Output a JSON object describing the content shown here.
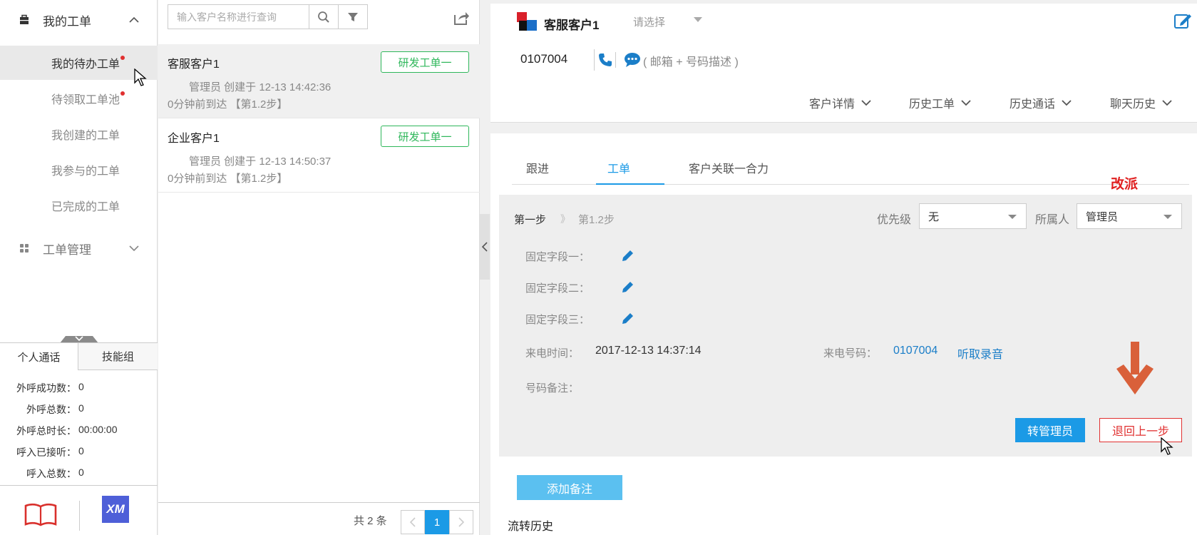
{
  "sidebar": {
    "group_my_tickets": "我的工单",
    "items": [
      {
        "label": "我的待办工单",
        "dot": true
      },
      {
        "label": "待领取工单池",
        "dot": true
      },
      {
        "label": "我创建的工单",
        "dot": false
      },
      {
        "label": "我参与的工单",
        "dot": false
      },
      {
        "label": "已完成的工单",
        "dot": false
      }
    ],
    "group_ticket_mgmt": "工单管理",
    "stats_tabs": [
      "个人通话",
      "技能组"
    ],
    "stats": [
      {
        "label": "外呼成功数：",
        "value": "0"
      },
      {
        "label": "外呼总数：",
        "value": "0"
      },
      {
        "label": "外呼总时长：",
        "value": "00:00:00"
      },
      {
        "label": "呼入已接听：",
        "value": "0"
      },
      {
        "label": "呼入总数：",
        "value": "0"
      }
    ],
    "bottom_logo_text": "XM"
  },
  "list": {
    "search_placeholder": "输入客户名称进行查询",
    "cards": [
      {
        "title": "客服客户1",
        "tag": "研发工单一",
        "meta": "管理员 创建于 12-13 14:42:36",
        "arrival": "0分钟前到达 【第1.2步】"
      },
      {
        "title": "企业客户1",
        "tag": "研发工单一",
        "meta": "管理员 创建于 12-13 14:50:37",
        "arrival": "0分钟前到达 【第1.2步】"
      }
    ],
    "total": "共 2 条",
    "page": "1"
  },
  "customer": {
    "name": "客服客户1",
    "select_placeholder": "请选择",
    "phone": "0107004",
    "contact_desc": "( 邮箱 + 号码描述 )",
    "tabs": [
      "客户详情",
      "历史工单",
      "历史通话",
      "聊天历史"
    ]
  },
  "main": {
    "tabs": [
      "跟进",
      "工单",
      "客户关联一合力"
    ],
    "annotation": "改派",
    "step1": "第一步",
    "step_sep": "》",
    "step2": "第1.2步",
    "priority_label": "优先级",
    "priority_value": "无",
    "owner_label": "所属人",
    "owner_value": "管理员",
    "fields": [
      "固定字段一：",
      "固定字段二：",
      "固定字段三："
    ],
    "call_time_label": "来电时间：",
    "call_time_value": "2017-12-13 14:37:14",
    "call_number_label": "来电号码：",
    "call_number_value": "0107004",
    "listen_link": "听取录音",
    "number_note_label": "号码备注：",
    "btn_transfer": "转管理员",
    "btn_back": "退回上一步",
    "btn_add_note": "添加备注",
    "history_title": "流转历史"
  },
  "colors": {
    "accent": "#1b9ae6",
    "tag_green": "#2fb75b",
    "danger": "#e03030",
    "arrow": "#d9603a"
  }
}
